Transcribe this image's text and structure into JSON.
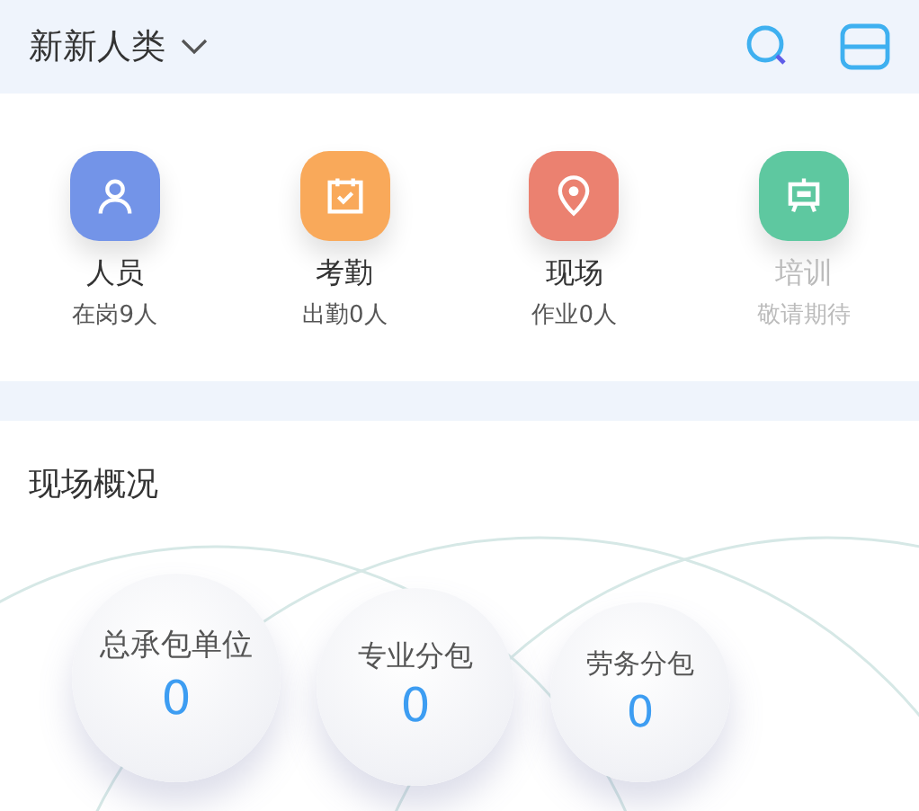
{
  "header": {
    "title": "新新人类"
  },
  "features": [
    {
      "kind": "person",
      "label": "人员",
      "sub": "在岗9人",
      "color": "#7394e8",
      "disabled": false
    },
    {
      "kind": "calendar",
      "label": "考勤",
      "sub": "出勤0人",
      "color": "#f9a95a",
      "disabled": false
    },
    {
      "kind": "pin",
      "label": "现场",
      "sub": "作业0人",
      "color": "#eb8170",
      "disabled": false
    },
    {
      "kind": "easel",
      "label": "培训",
      "sub": "敬请期待",
      "color": "#5ec8a0",
      "disabled": true
    }
  ],
  "overview": {
    "title": "现场概况",
    "units": [
      {
        "label": "总承包单位",
        "value": "0"
      },
      {
        "label": "专业分包",
        "value": "0"
      },
      {
        "label": "劳务分包",
        "value": "0"
      }
    ]
  }
}
